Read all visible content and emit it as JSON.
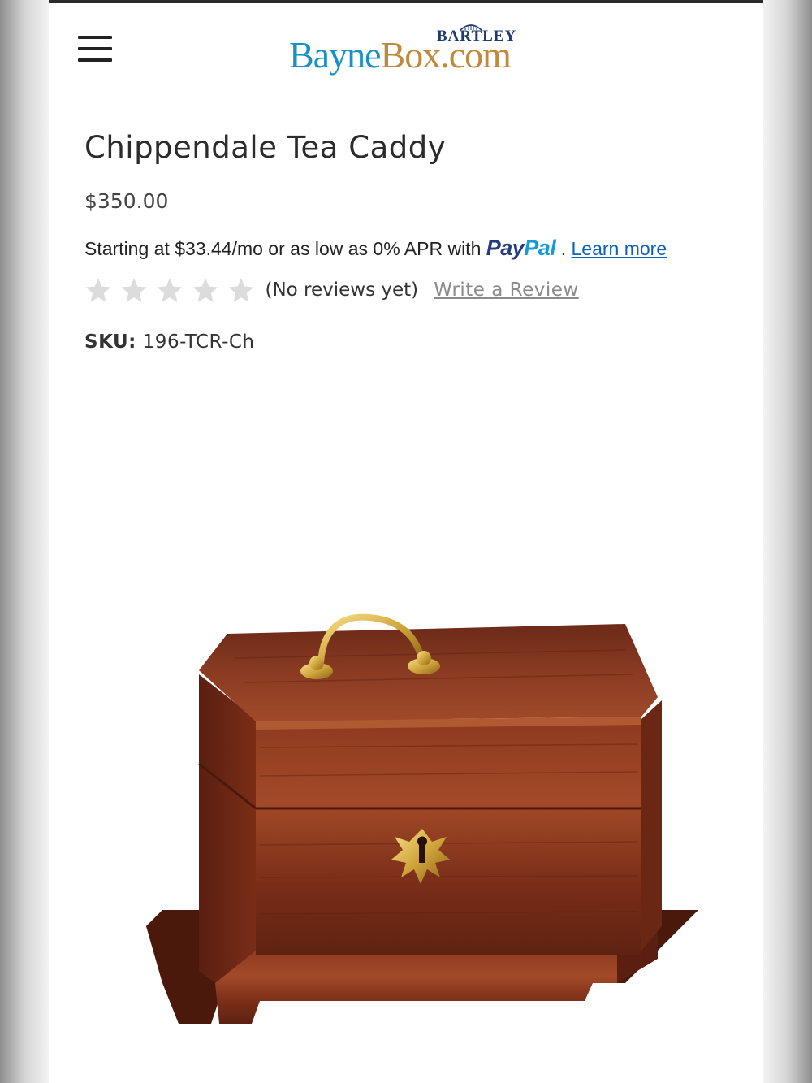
{
  "header": {
    "logo": {
      "top_text": "BARTLEY",
      "part_a": "Bayne",
      "part_b": "Box.com"
    },
    "menu_icon": "hamburger-menu-icon"
  },
  "product": {
    "title": "Chippendale Tea Caddy",
    "price": "$350.00",
    "financing": {
      "text": "Starting at $33.44/mo or as low as 0% APR with",
      "paypal_pay": "Pay",
      "paypal_pal": "Pal",
      "separator": ".",
      "learn_more": "Learn more"
    },
    "reviews": {
      "rating": 0,
      "max_rating": 5,
      "count_text": "(No reviews yet)",
      "write_review": "Write a Review"
    },
    "sku": {
      "label": "SKU:",
      "value": "196-TCR-Ch"
    },
    "image": "mahogany tea caddy box with brass handle and keyhole escutcheon"
  },
  "colors": {
    "logo_blue": "#1a8fc4",
    "logo_gold": "#c08a3e",
    "paypal_dark": "#253b80",
    "paypal_light": "#179bd7",
    "link_blue": "#0b62b8",
    "star_empty": "#dcdcdc"
  }
}
